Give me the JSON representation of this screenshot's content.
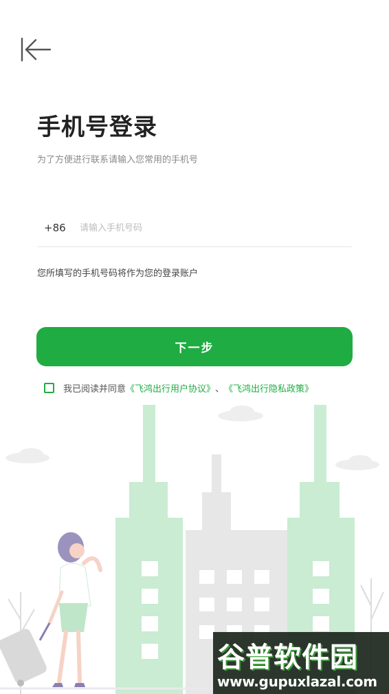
{
  "header": {
    "back_icon": "back-arrow-icon"
  },
  "login": {
    "title": "手机号登录",
    "subtitle": "为了方便进行联系请输入您常用的手机号",
    "country_code": "+86",
    "phone_placeholder": "请输入手机号码",
    "phone_value": "",
    "hint": "您所填写的手机号码将作为您的登录账户",
    "next_label": "下一步"
  },
  "agreement": {
    "checked": false,
    "prefix": "我已阅读并同意",
    "user_agreement": "《飞鸿出行用户协议》",
    "separator": "、",
    "privacy_policy": "《飞鸿出行隐私政策》"
  },
  "watermark": {
    "logo_text": "谷普软件园",
    "url": "www.gupuxlazal.com"
  },
  "colors": {
    "accent": "#1fac42",
    "building_green": "#c9ecd2",
    "building_gray": "#e6e6e6"
  }
}
